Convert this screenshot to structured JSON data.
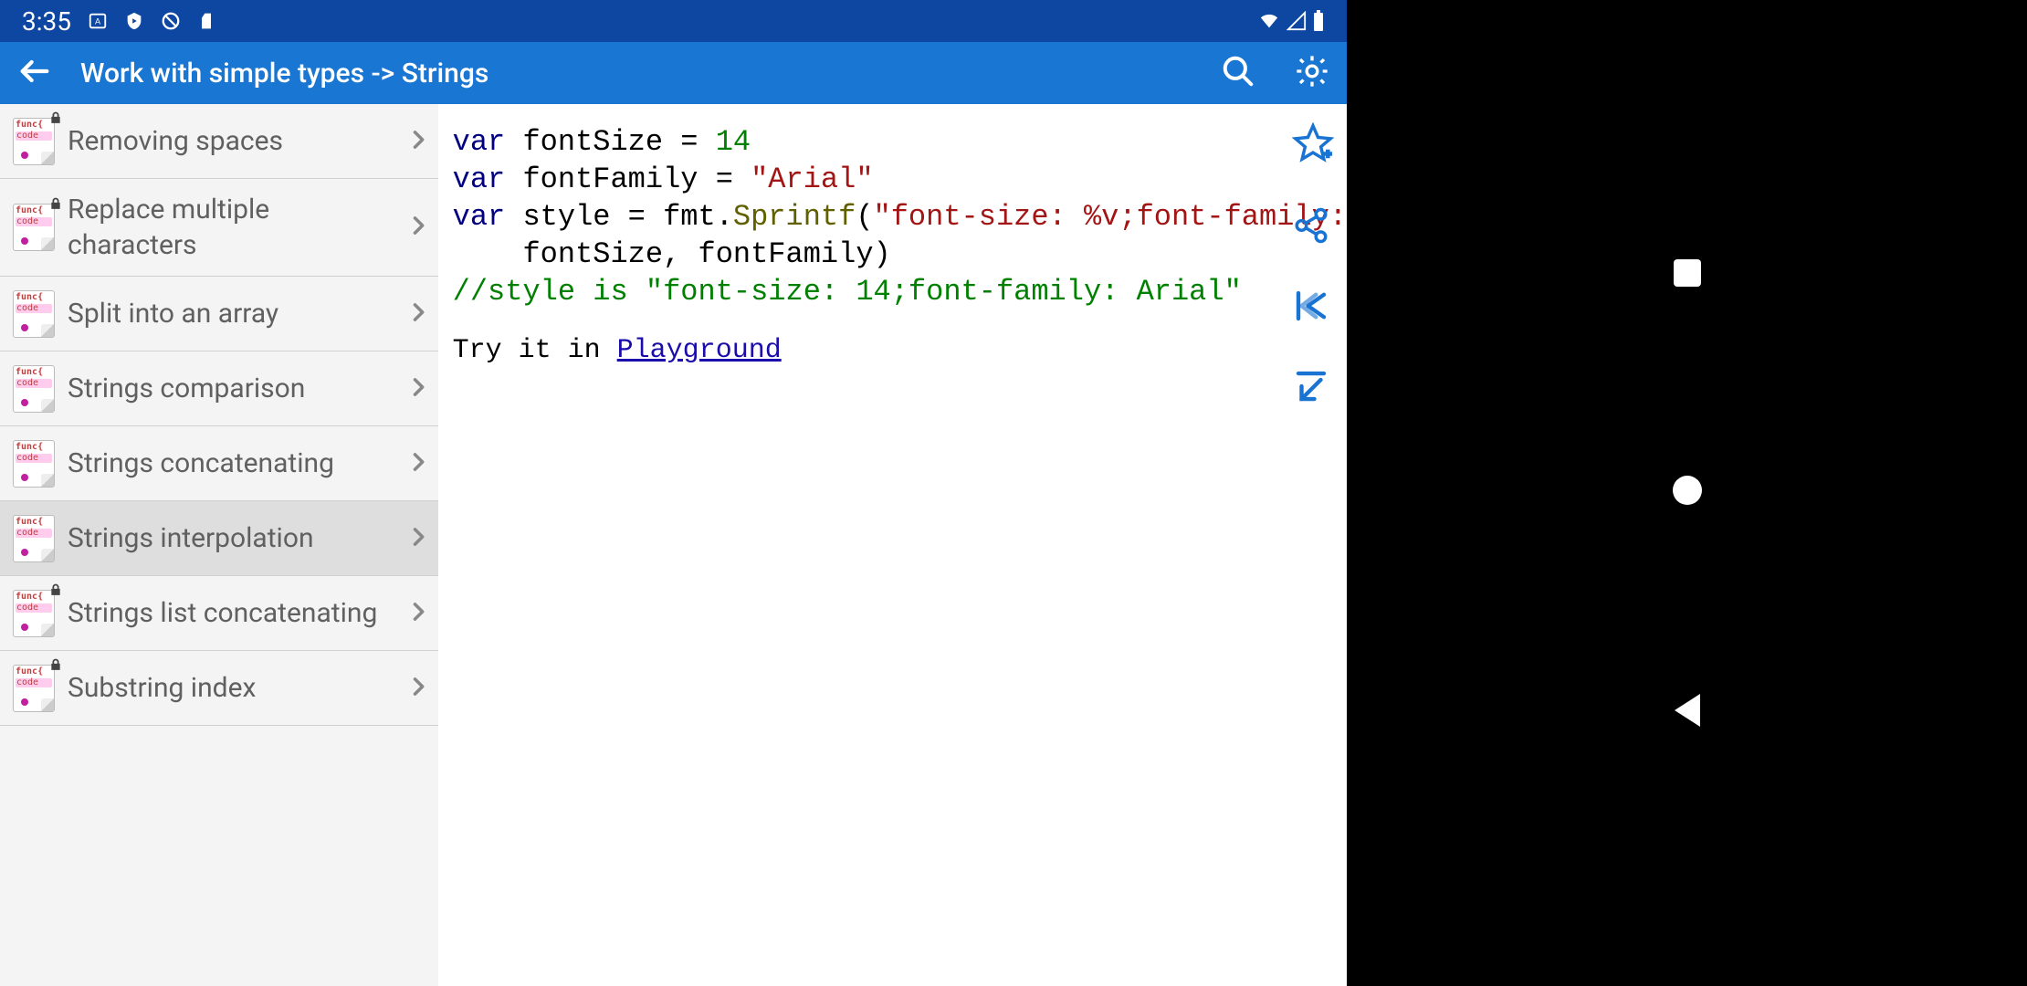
{
  "status": {
    "time": "3:35"
  },
  "appbar": {
    "title": "Work with simple types -> Strings"
  },
  "sidebar": {
    "items": [
      {
        "label": "Removing spaces",
        "locked": true,
        "selected": false
      },
      {
        "label": "Replace multiple characters",
        "locked": true,
        "selected": false
      },
      {
        "label": "Split into an array",
        "locked": false,
        "selected": false
      },
      {
        "label": "Strings comparison",
        "locked": false,
        "selected": false
      },
      {
        "label": "Strings concatenating",
        "locked": false,
        "selected": false
      },
      {
        "label": "Strings interpolation",
        "locked": false,
        "selected": true
      },
      {
        "label": "Strings list concatenating",
        "locked": true,
        "selected": false
      },
      {
        "label": "Substring index",
        "locked": true,
        "selected": false
      }
    ]
  },
  "code": {
    "tokens": [
      [
        {
          "t": "var",
          "c": "kw"
        },
        {
          "t": " fontSize = ",
          "c": "ident"
        },
        {
          "t": "14",
          "c": "num"
        }
      ],
      [
        {
          "t": "var",
          "c": "kw"
        },
        {
          "t": " fontFamily = ",
          "c": "ident"
        },
        {
          "t": "\"Arial\"",
          "c": "str"
        }
      ],
      [
        {
          "t": "var",
          "c": "kw"
        },
        {
          "t": " style = fmt.",
          "c": "ident"
        },
        {
          "t": "Sprintf",
          "c": "call"
        },
        {
          "t": "(",
          "c": "ident"
        },
        {
          "t": "\"font-size: %v;font-family:",
          "c": "str"
        }
      ],
      [
        {
          "t": "    fontSize, fontFamily)",
          "c": "ident"
        }
      ],
      [
        {
          "t": "//style is \"font-size: 14;font-family: Arial\"",
          "c": "com"
        }
      ]
    ],
    "try_prefix": "Try it in ",
    "try_link": "Playground"
  }
}
